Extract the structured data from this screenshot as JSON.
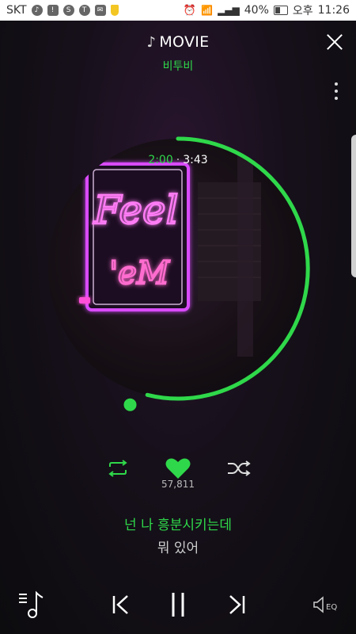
{
  "status_bar": {
    "carrier": "SKT",
    "battery": "40%",
    "ampm": "오후",
    "time": "11:26"
  },
  "header": {
    "title": "MOVIE",
    "artist": "비투비"
  },
  "album": {
    "art_text_1": "Feel",
    "art_text_2": "'eM"
  },
  "playback": {
    "current_time": "2:00",
    "separator": "·",
    "total_time": "3:43",
    "progress": 0.538
  },
  "like_count": "57,811",
  "lyrics": {
    "current": "넌 나 흥분시키는데",
    "next": "뭐 있어"
  },
  "bottom_bar": {
    "eq_label": "EQ"
  },
  "colors": {
    "accent": "#2fd84a",
    "neon": "#e34cff"
  }
}
